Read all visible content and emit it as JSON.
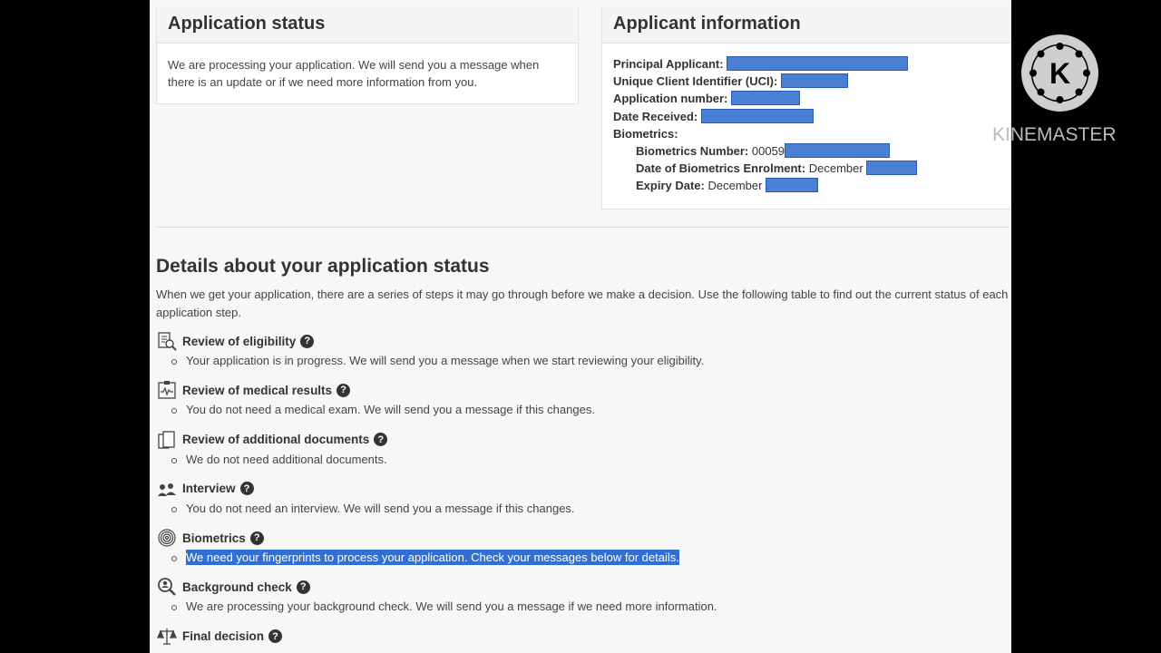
{
  "status_panel": {
    "title": "Application status",
    "message": "We are processing your application. We will send you a message when there is an update or if we need more information from you."
  },
  "info_panel": {
    "title": "Applicant information",
    "principal_label": "Principal Applicant:",
    "uci_label": "Unique Client Identifier (UCI):",
    "app_number_label": "Application number:",
    "date_received_label": "Date Received:",
    "biometrics_label": "Biometrics:",
    "bio_number_label": "Biometrics Number:",
    "bio_number_value": "00059",
    "bio_date_label": "Date of Biometrics Enrolment:",
    "bio_date_value": "December",
    "expiry_label": "Expiry Date:",
    "expiry_value": "December"
  },
  "details": {
    "title": "Details about your application status",
    "intro": "When we get your application, there are a series of steps it may go through before we make a decision. Use the following table to find out the current status of each application step.",
    "steps": [
      {
        "title": "Review of eligibility",
        "desc": "Your application is in progress. We will send you a message when we start reviewing your eligibility.",
        "icon": "eligibility-icon"
      },
      {
        "title": "Review of medical results",
        "desc": "You do not need a medical exam. We will send you a message if this changes.",
        "icon": "medical-icon"
      },
      {
        "title": "Review of additional documents",
        "desc": "We do not need additional documents.",
        "icon": "documents-icon"
      },
      {
        "title": "Interview",
        "desc": "You do not need an interview. We will send you a message if this changes.",
        "icon": "interview-icon"
      },
      {
        "title": "Biometrics",
        "desc": "We need your fingerprints to process your application. Check your messages below for details.",
        "icon": "fingerprint-icon"
      },
      {
        "title": "Background check",
        "desc": "We are processing your background check. We will send you a message if we need more information.",
        "icon": "background-check-icon"
      },
      {
        "title": "Final decision",
        "desc": "",
        "icon": "scales-icon"
      }
    ]
  },
  "watermark": {
    "letter": "K",
    "text": "KINEMASTER"
  }
}
